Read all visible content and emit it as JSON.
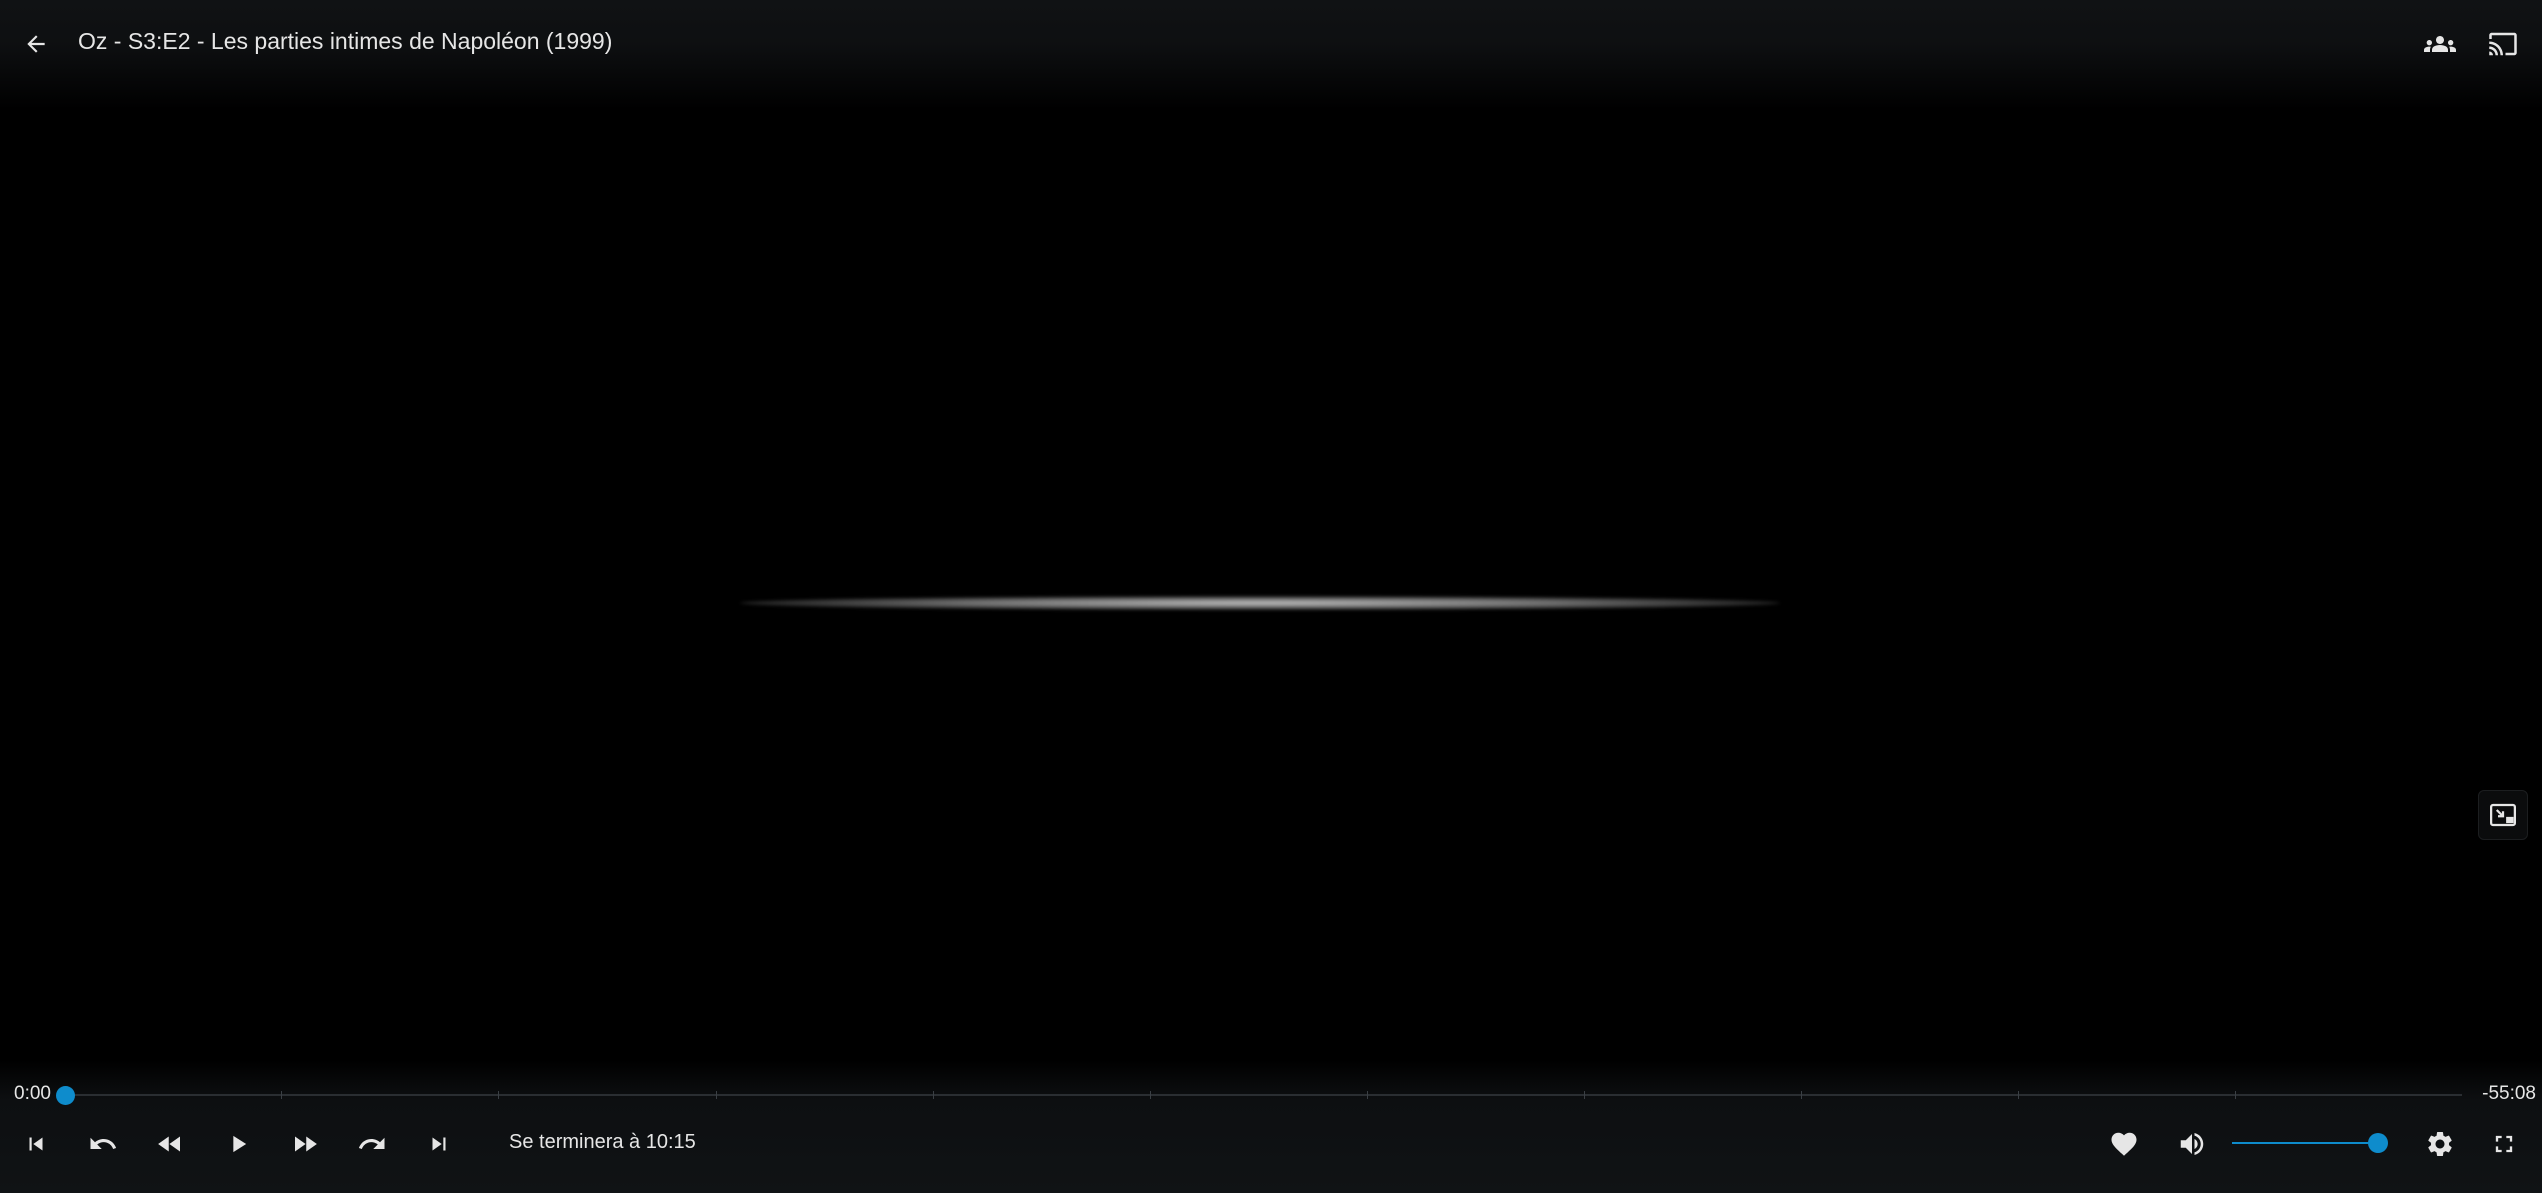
{
  "header": {
    "title": "Oz - S3:E2 - Les parties intimes de Napoléon (1999)",
    "back_icon": "arrow-left-icon",
    "people_icon": "people-icon",
    "cast_icon": "cast-icon"
  },
  "playback": {
    "current_time": "0:00",
    "remaining_time": "-55:08",
    "progress": 0,
    "ends_at_label": "Se terminera à 10:15",
    "volume": 1.0,
    "accent_color": "#0e8ccc"
  },
  "controls": {
    "icons": [
      "previous-track-icon",
      "replay-icon",
      "rewind-icon",
      "play-icon",
      "fast-forward-icon",
      "forward-icon",
      "next-track-icon"
    ],
    "right_icons": [
      "heart-icon",
      "volume-icon",
      "gear-icon",
      "fullscreen-icon"
    ]
  },
  "overlay": {
    "pip_icon": "picture-in-picture-icon"
  }
}
